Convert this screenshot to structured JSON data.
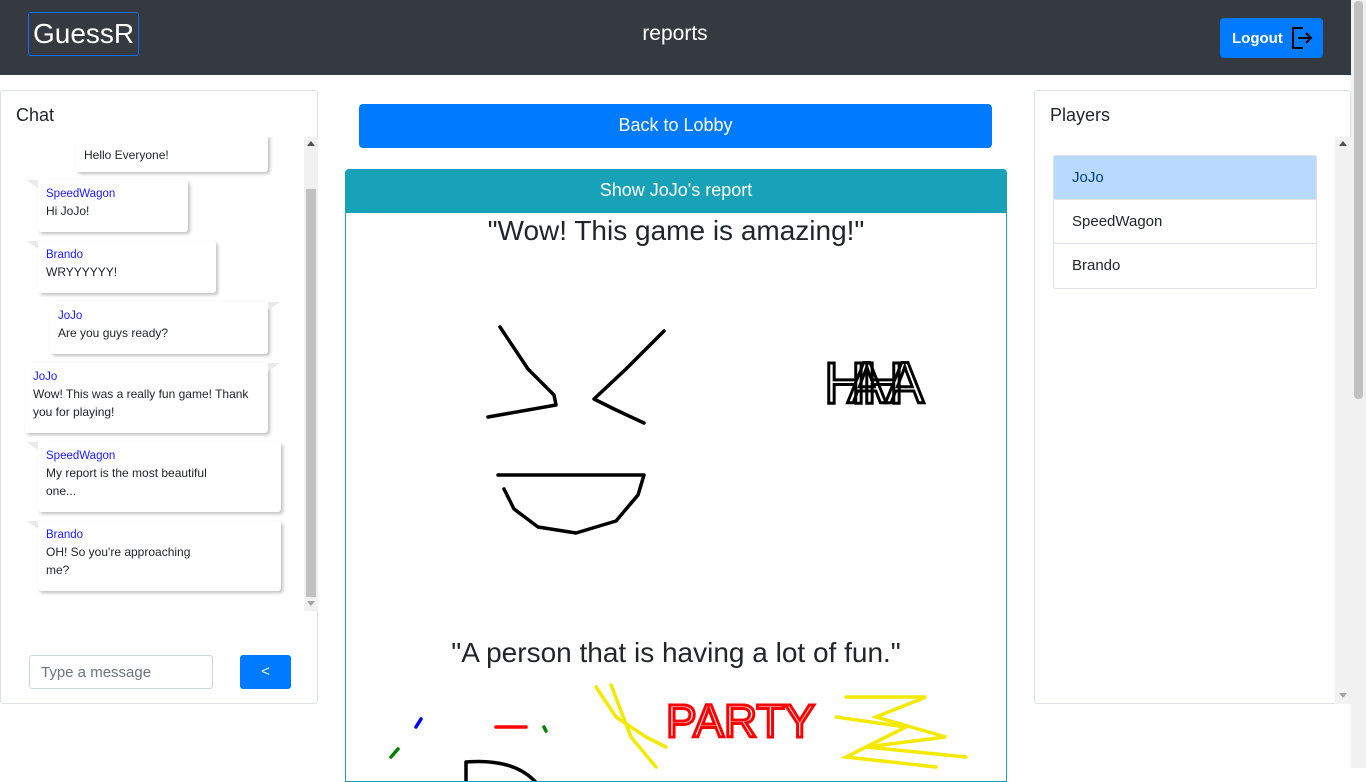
{
  "nav": {
    "brand": "GuessR",
    "title": "reports",
    "logout_label": "Logout"
  },
  "chat": {
    "title": "Chat",
    "messages": [
      {
        "author": "",
        "text": "Hello Everyone!"
      },
      {
        "author": "SpeedWagon",
        "text": "Hi JoJo!"
      },
      {
        "author": "Brando",
        "text": "WRYYYYYY!"
      },
      {
        "author": "JoJo",
        "text": "Are you guys ready?"
      },
      {
        "author": "JoJo",
        "text": "Wow! This was a really fun game! Thank you for playing!"
      },
      {
        "author": "SpeedWagon",
        "text": "My report is the most beautiful one..."
      },
      {
        "author": "Brando",
        "text": "OH! So you're approaching me?"
      }
    ],
    "input_placeholder": "Type a message",
    "send_label": "<"
  },
  "center": {
    "back_label": "Back to Lobby",
    "report_label": "Show JoJo's report",
    "captions": [
      "\"Wow! This game is amazing!\"",
      "\"A person that is having a lot of fun.\""
    ],
    "drawing_text_1": "HA HA",
    "drawing_text_2": "PARTY"
  },
  "players": {
    "title": "Players",
    "list": [
      "JoJo",
      "SpeedWagon",
      "Brando"
    ],
    "active_index": 0
  },
  "colors": {
    "navbar": "#343a40",
    "primary": "#007bff",
    "info": "#17a2b8",
    "active_player": "#b8daff"
  }
}
